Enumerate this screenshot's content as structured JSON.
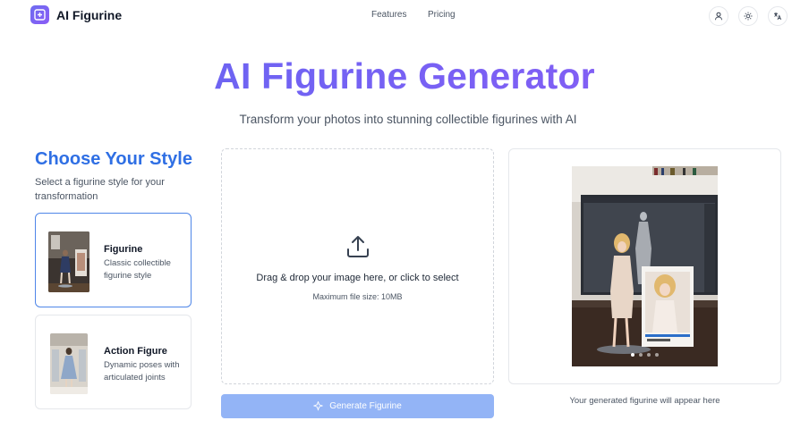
{
  "header": {
    "app_name": "AI Figurine",
    "nav": [
      "Features",
      "Pricing"
    ],
    "icons": [
      "user-icon",
      "sun-icon",
      "translate-icon"
    ]
  },
  "hero": {
    "title": "AI Figurine Generator",
    "subtitle": "Transform your photos into stunning collectible figurines with AI"
  },
  "styles": {
    "title": "Choose Your Style",
    "description": "Select a figurine style for your transformation",
    "options": [
      {
        "name": "Figurine",
        "description": "Classic collectible figurine style",
        "selected": true
      },
      {
        "name": "Action Figure",
        "description": "Dynamic poses with articulated joints",
        "selected": false
      }
    ]
  },
  "upload": {
    "prompt": "Drag & drop your image here, or click to select",
    "limit": "Maximum file size: 10MB",
    "generate_label": "Generate Figurine"
  },
  "preview": {
    "caption": "Your generated figurine will appear here",
    "carousel_count": 4,
    "active_index": 0
  },
  "colors": {
    "accent": "#2f6fe4",
    "gradient_start": "#6366f1",
    "gradient_end": "#8b5cf6",
    "button_disabled": "#93b4f6"
  }
}
